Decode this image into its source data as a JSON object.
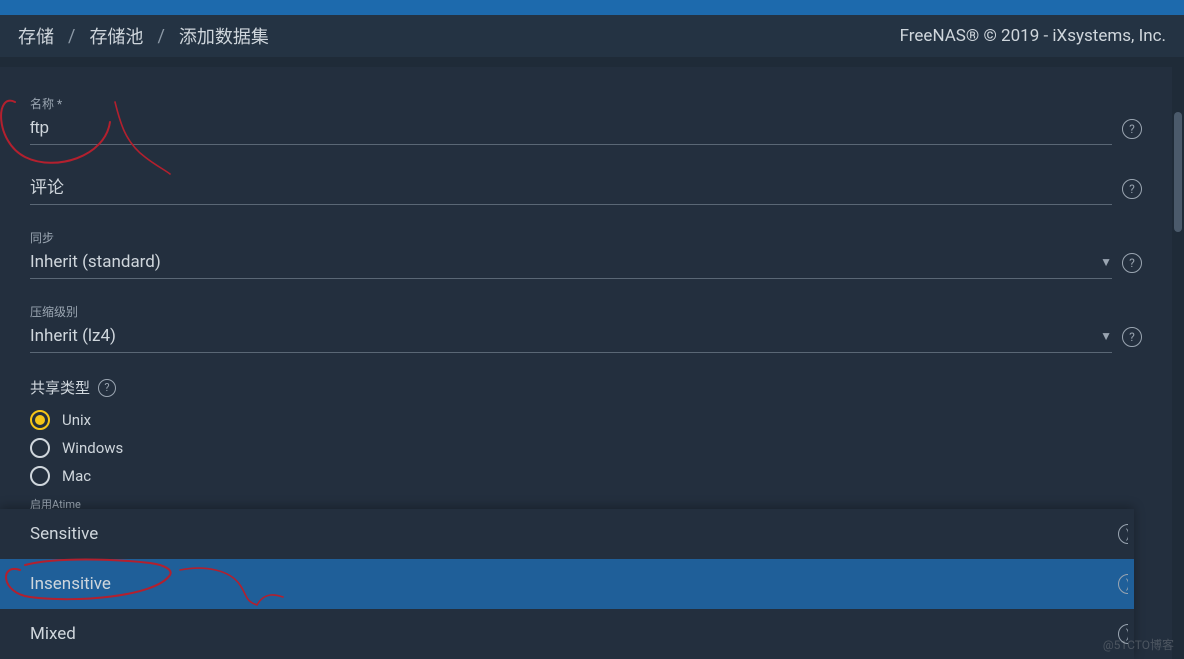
{
  "breadcrumb": {
    "item1": "存储",
    "item2": "存储池",
    "item3": "添加数据集"
  },
  "copyright": "FreeNAS® © 2019 - iXsystems, Inc.",
  "fields": {
    "name": {
      "label": "名称 *",
      "value": "ftp"
    },
    "comment": {
      "label": "评论",
      "value": ""
    },
    "sync": {
      "label": "同步",
      "value": "Inherit (standard)"
    },
    "compression": {
      "label": "压缩级别",
      "value": "Inherit (lz4)"
    }
  },
  "share_type": {
    "title": "共享类型",
    "options": {
      "unix": "Unix",
      "windows": "Windows",
      "mac": "Mac"
    },
    "selected": "unix"
  },
  "atime_label": "启用Atime",
  "case_sensitivity_options": {
    "sensitive": "Sensitive",
    "insensitive": "Insensitive",
    "mixed": "Mixed"
  },
  "watermark": "@51CTO博客"
}
